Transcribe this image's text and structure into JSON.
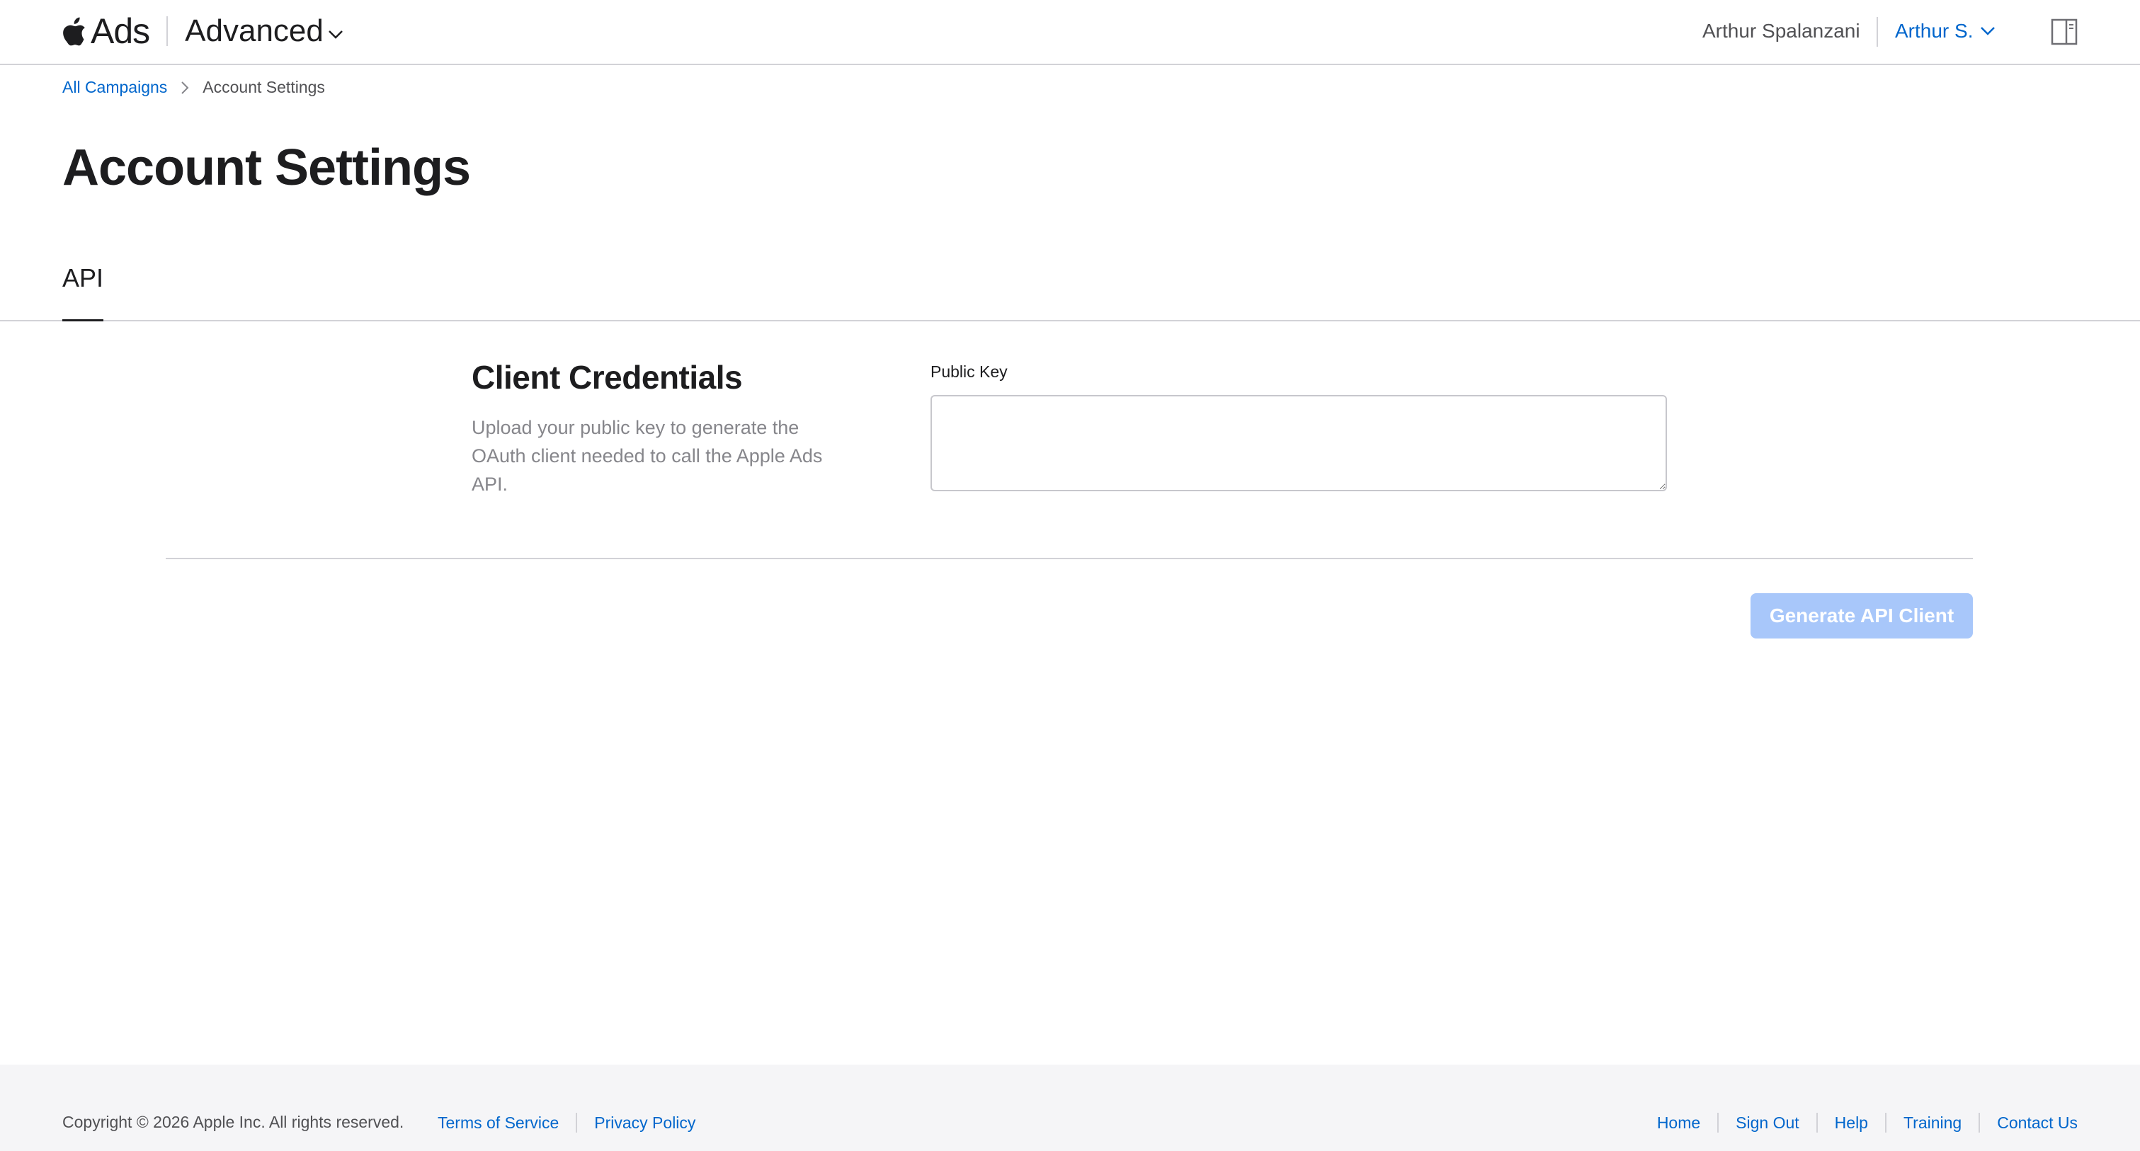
{
  "header": {
    "brand_name": "Ads",
    "product_name": "Advanced",
    "account_name": "Arthur Spalanzani",
    "user_menu_label": "Arthur S."
  },
  "breadcrumb": {
    "items": [
      {
        "label": "All Campaigns"
      },
      {
        "label": "Account Settings"
      }
    ]
  },
  "page": {
    "title": "Account Settings"
  },
  "tabs": [
    {
      "label": "API",
      "active": true
    }
  ],
  "credentials": {
    "title": "Client Credentials",
    "description": "Upload your public key to generate the OAuth client needed to call the Apple Ads API.",
    "public_key_label": "Public Key",
    "public_key_value": "",
    "generate_button_label": "Generate API Client"
  },
  "footer": {
    "copyright": "Copyright © 2026 Apple Inc. All rights reserved.",
    "left_links": [
      {
        "label": "Terms of Service"
      },
      {
        "label": "Privacy Policy"
      }
    ],
    "right_links": [
      {
        "label": "Home"
      },
      {
        "label": "Sign Out"
      },
      {
        "label": "Help"
      },
      {
        "label": "Training"
      },
      {
        "label": "Contact Us"
      }
    ]
  },
  "colors": {
    "link": "#0066cc",
    "button_disabled": "#a8c7fa",
    "divider": "#d2d2d7",
    "muted_text": "#86868b"
  }
}
